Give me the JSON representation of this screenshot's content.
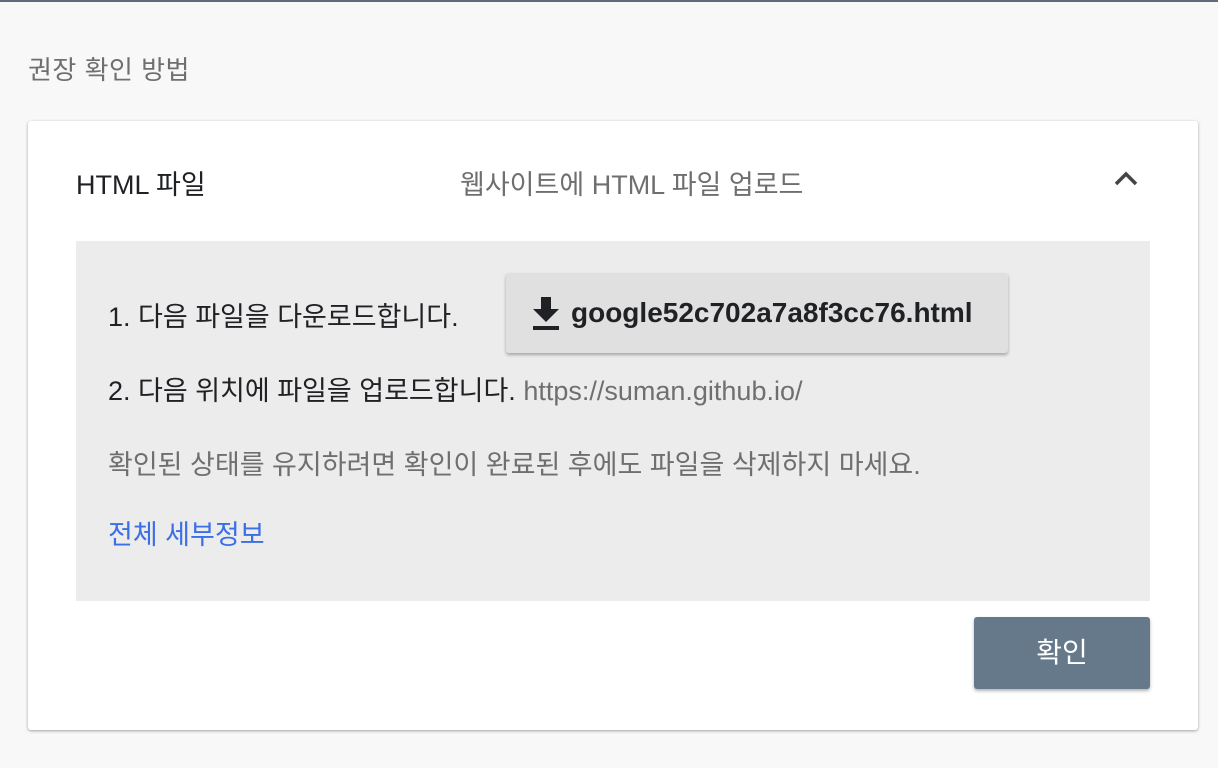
{
  "section": {
    "title": "권장 확인 방법"
  },
  "method": {
    "name": "HTML 파일",
    "description": "웹사이트에 HTML 파일 업로드",
    "collapse_icon": "chevron-up-icon"
  },
  "steps": {
    "step1_label": "1. 다음 파일을 다운로드합니다.",
    "download_icon": "download-icon",
    "download_file": "google52c702a7a8f3cc76.html",
    "step2_label": "2. 다음 위치에 파일을 업로드합니다.",
    "upload_url": "https://suman.github.io/"
  },
  "notice": "확인된 상태를 유지하려면 확인이 완료된 후에도 파일을 삭제하지 마세요.",
  "details_link": "전체 세부정보",
  "confirm_button": "확인",
  "colors": {
    "link": "#3c6ee6",
    "confirm_button_bg": "#66798a",
    "panel_bg": "#ececec"
  }
}
